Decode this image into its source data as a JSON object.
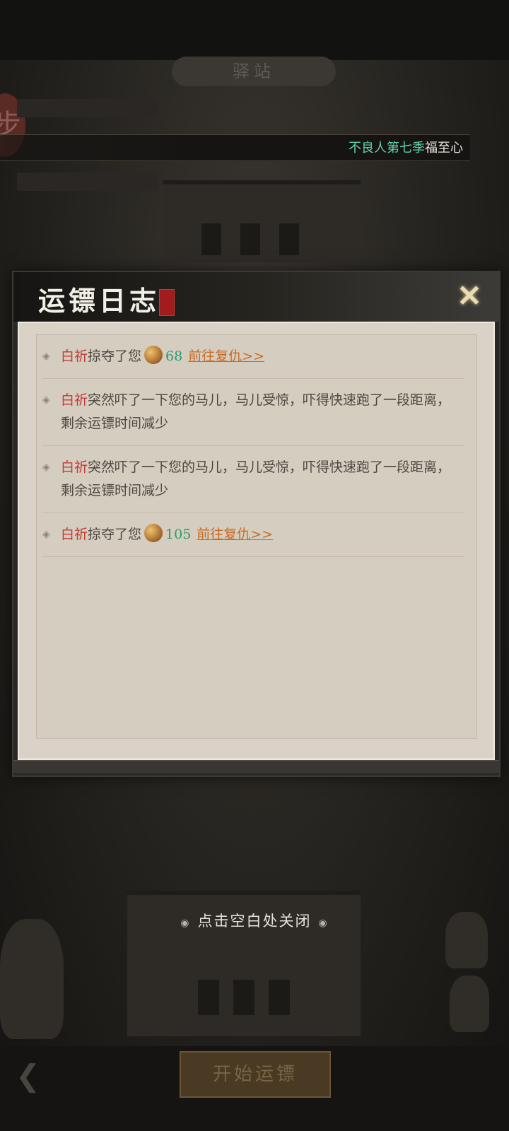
{
  "background": {
    "station_title": "驿站",
    "announcement": {
      "highlight": "不良人第七季",
      "text": "福至心"
    },
    "start_button": "开始运镖"
  },
  "dialog": {
    "title": "运镖日志",
    "logs": [
      {
        "name": "白祈",
        "action": "掠夺了您",
        "amount": "68",
        "revenge": "前往复仇>>"
      },
      {
        "name": "白祈",
        "text": "突然吓了一下您的马儿，马儿受惊，吓得快速跑了一段距离，剩余运镖时间减少"
      },
      {
        "name": "白祈",
        "text": "突然吓了一下您的马儿，马儿受惊，吓得快速跑了一段距离，剩余运镖时间减少"
      },
      {
        "name": "白祈",
        "action": "掠夺了您",
        "amount": "105",
        "revenge": "前往复仇>>"
      }
    ]
  },
  "close_hint": "点击空白处关闭"
}
